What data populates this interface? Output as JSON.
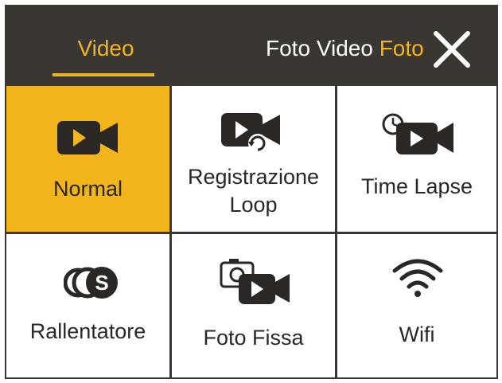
{
  "header": {
    "tab_active_label": "Video",
    "tab_foto_label": "Foto",
    "tab_video_label": "Video",
    "tab_foto2_label": "Foto",
    "close_icon": "close-icon"
  },
  "modes": [
    {
      "label_line1": "Normal",
      "label_line2": "",
      "icon": "video-camera-icon",
      "selected": true
    },
    {
      "label_line1": "Registrazione",
      "label_line2": "Loop",
      "icon": "loop-video-icon",
      "selected": false
    },
    {
      "label_line1": "Time Lapse",
      "label_line2": "",
      "icon": "timelapse-video-icon",
      "selected": false
    },
    {
      "label_line1": "Rallentatore",
      "label_line2": "",
      "icon": "slow-motion-icon",
      "selected": false
    },
    {
      "label_line1": "Foto Fissa",
      "label_line2": "",
      "icon": "photo-video-icon",
      "selected": false
    },
    {
      "label_line1": "Wifi",
      "label_line2": "",
      "icon": "wifi-icon",
      "selected": false
    }
  ],
  "colors": {
    "accent": "#f2b51c",
    "topbar": "#3a3632",
    "text": "#2b2724",
    "white": "#ffffff"
  }
}
